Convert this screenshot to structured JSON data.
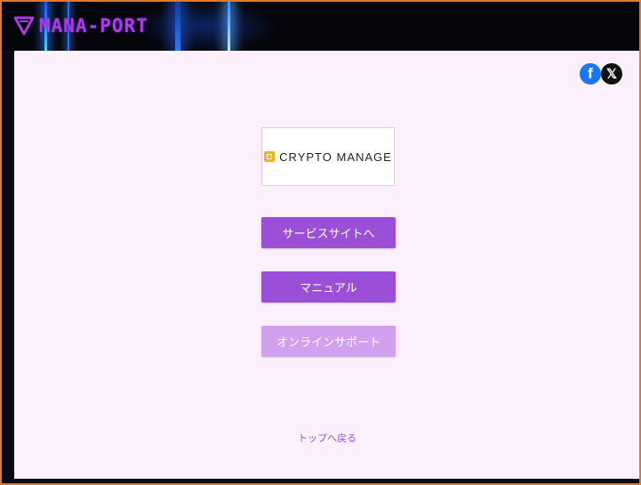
{
  "header": {
    "logo_text": "MANA-PORT",
    "logo_icon": "mana-port-v-logo-icon",
    "accent_color": "#a93be8"
  },
  "social": {
    "facebook_label": "f",
    "facebook_icon": "facebook-icon",
    "x_label": "𝕏",
    "x_icon": "x-icon"
  },
  "brand": {
    "name": "CRYPTO MANAGE",
    "icon": "crypto-manage-icon",
    "icon_color": "#f2b417"
  },
  "buttons": {
    "service_site": "サービスサイトへ",
    "manual": "マニュアル",
    "online_support": "オンラインサポート"
  },
  "links": {
    "back_to_top": "トップへ戻る"
  },
  "colors": {
    "button_primary": "#9b4fd6",
    "button_disabled": "#d2a1ee",
    "content_background": "#fbf0fc"
  }
}
